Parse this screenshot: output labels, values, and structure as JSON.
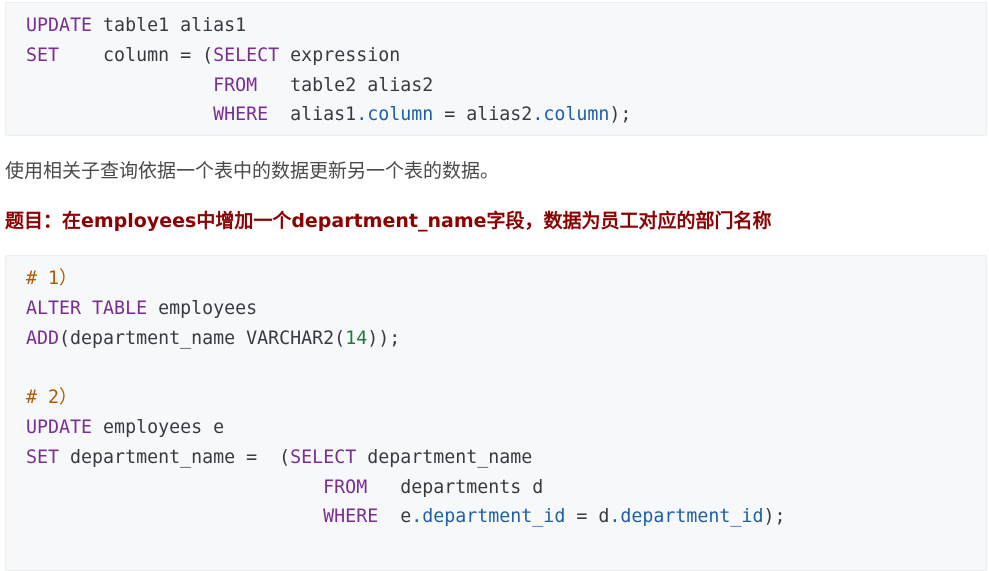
{
  "code_block_1": {
    "lines": [
      [
        {
          "t": "kw",
          "v": "UPDATE"
        },
        {
          "t": "pl",
          "v": " table1 alias1"
        }
      ],
      [
        {
          "t": "kw",
          "v": "SET"
        },
        {
          "t": "pl",
          "v": "    column = ("
        },
        {
          "t": "kw",
          "v": "SELECT"
        },
        {
          "t": "pl",
          "v": " expression"
        }
      ],
      [
        {
          "t": "pl",
          "v": "                 "
        },
        {
          "t": "kw",
          "v": "FROM"
        },
        {
          "t": "pl",
          "v": "   table2 alias2"
        }
      ],
      [
        {
          "t": "pl",
          "v": "                 "
        },
        {
          "t": "kw",
          "v": "WHERE"
        },
        {
          "t": "pl",
          "v": "  alias1"
        },
        {
          "t": "prop",
          "v": ".column"
        },
        {
          "t": "pl",
          "v": " = alias2"
        },
        {
          "t": "prop",
          "v": ".column"
        },
        {
          "t": "pl",
          "v": ");"
        }
      ]
    ]
  },
  "paragraph": "使用相关子查询依据一个表中的数据更新另一个表的数据。",
  "heading": "题目：在employees中增加一个department_name字段，数据为员工对应的部门名称",
  "code_block_2": {
    "lines": [
      [
        {
          "t": "cm",
          "v": "# 1）"
        }
      ],
      [
        {
          "t": "kw",
          "v": "ALTER"
        },
        {
          "t": "pl",
          "v": " "
        },
        {
          "t": "kw",
          "v": "TABLE"
        },
        {
          "t": "pl",
          "v": " employees"
        }
      ],
      [
        {
          "t": "kw",
          "v": "ADD"
        },
        {
          "t": "pl",
          "v": "(department_name VARCHAR2("
        },
        {
          "t": "num",
          "v": "14"
        },
        {
          "t": "pl",
          "v": "));"
        }
      ],
      [],
      [
        {
          "t": "cm",
          "v": "# 2）"
        }
      ],
      [
        {
          "t": "kw",
          "v": "UPDATE"
        },
        {
          "t": "pl",
          "v": " employees e"
        }
      ],
      [
        {
          "t": "kw",
          "v": "SET"
        },
        {
          "t": "pl",
          "v": " department_name =  ("
        },
        {
          "t": "kw",
          "v": "SELECT"
        },
        {
          "t": "pl",
          "v": " department_name"
        }
      ],
      [
        {
          "t": "pl",
          "v": "                           "
        },
        {
          "t": "kw",
          "v": "FROM"
        },
        {
          "t": "pl",
          "v": "   departments d"
        }
      ],
      [
        {
          "t": "pl",
          "v": "                           "
        },
        {
          "t": "kw",
          "v": "WHERE"
        },
        {
          "t": "pl",
          "v": "  e"
        },
        {
          "t": "prop",
          "v": ".department_id"
        },
        {
          "t": "pl",
          "v": " = d"
        },
        {
          "t": "prop",
          "v": ".department_id"
        },
        {
          "t": "pl",
          "v": ");"
        }
      ]
    ]
  }
}
